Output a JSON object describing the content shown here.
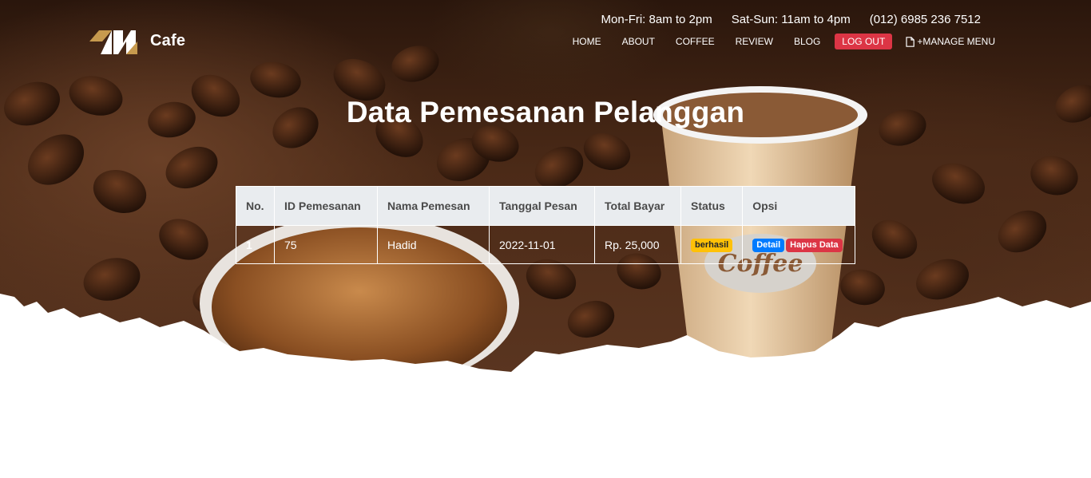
{
  "brand": {
    "name": "Cafe"
  },
  "contact": {
    "weekday_hours": "Mon-Fri: 8am to 2pm",
    "weekend_hours": "Sat-Sun: 11am to 4pm",
    "phone": "(012) 6985 236 7512"
  },
  "nav": {
    "items": [
      {
        "label": "HOME"
      },
      {
        "label": "ABOUT"
      },
      {
        "label": "COFFEE"
      },
      {
        "label": "REVIEW"
      },
      {
        "label": "BLOG"
      }
    ],
    "logout_label": "LOG OUT",
    "manage_label": "+MANAGE MENU",
    "manage_icon": "file-icon"
  },
  "page": {
    "title": "Data Pemesanan Pelanggan"
  },
  "table": {
    "headers": [
      "No.",
      "ID Pemesanan",
      "Nama Pemesan",
      "Tanggal Pesan",
      "Total Bayar",
      "Status",
      "Opsi"
    ],
    "rows": [
      {
        "no": "1",
        "id": "75",
        "name": "Hadid",
        "date": "2022-11-01",
        "total": "Rp. 25,000",
        "status": "berhasil",
        "detail_label": "Detail",
        "delete_label": "Hapus Data"
      }
    ]
  },
  "decor": {
    "cup_print": "Coffee"
  },
  "colors": {
    "danger": "#dc3545",
    "primary": "#007bff",
    "warning": "#ffc107",
    "header_bg": "#e9ecef"
  }
}
